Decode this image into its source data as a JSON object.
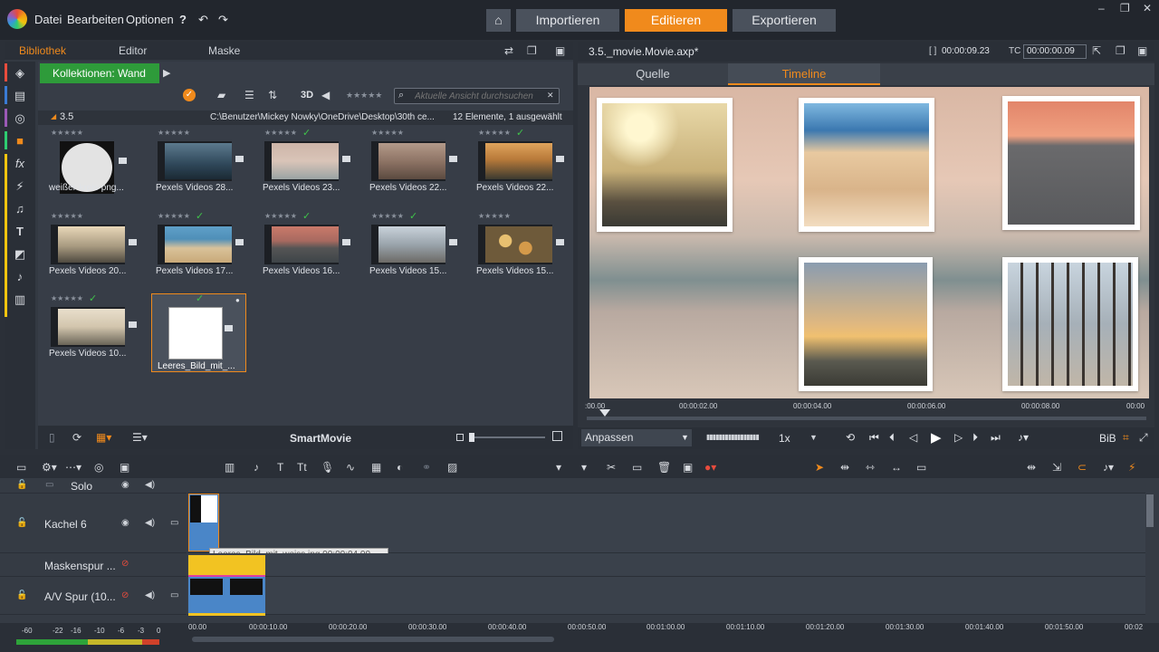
{
  "menu": {
    "datei": "Datei",
    "bearbeiten": "Bearbeiten",
    "optionen": "Optionen"
  },
  "modes": {
    "importieren": "Importieren",
    "editieren": "Editieren",
    "exportieren": "Exportieren"
  },
  "lib_tabs": {
    "bibliothek": "Bibliothek",
    "editor": "Editor",
    "maske": "Maske"
  },
  "collection": {
    "label": "Kollektionen: Wand"
  },
  "toolbar": {
    "three_d": "3D",
    "search_placeholder": "Aktuelle Ansicht durchsuchen"
  },
  "path": {
    "folder": "3.5",
    "path": "C:\\Benutzer\\Mickey Nowky\\OneDrive\\Desktop\\30th ce...",
    "count": "12 Elemente, 1 ausgewählt"
  },
  "items": [
    {
      "label": "weißer-kreis-png..."
    },
    {
      "label": "Pexels Videos 28..."
    },
    {
      "label": "Pexels Videos 23..."
    },
    {
      "label": "Pexels Videos 22..."
    },
    {
      "label": "Pexels Videos 22..."
    },
    {
      "label": "Pexels Videos 20..."
    },
    {
      "label": "Pexels Videos 17..."
    },
    {
      "label": "Pexels Videos 16..."
    },
    {
      "label": "Pexels Videos 15..."
    },
    {
      "label": "Pexels Videos 15..."
    },
    {
      "label": "Pexels Videos 10..."
    },
    {
      "label": "Leeres_Bild_mit_..."
    }
  ],
  "lib_bottom": {
    "smartmovie": "SmartMovie"
  },
  "preview": {
    "filename": "3.5._movie.Movie.axp*",
    "duration": "00:00:09.23",
    "tc_label": "TC",
    "timecode": "00:00:00.09",
    "tab_quelle": "Quelle",
    "tab_timeline": "Timeline"
  },
  "scrub_labels": [
    ":00.00",
    "00:00:02.00",
    "00:00:04.00",
    "00:00:06.00",
    "00:00:08.00",
    "00:00"
  ],
  "controls": {
    "fit": "Anpassen",
    "speed": "1x",
    "bib": "BiB"
  },
  "tracks": {
    "solo": "Solo",
    "kachel": "Kachel 6",
    "maske": "Maskenspur ...",
    "av": "A/V Spur (10..."
  },
  "tooltip": "Leeres_Bild_mit_weiss.jpg  00:00:04.00",
  "meter_labels": [
    "-60",
    "-22",
    "-16",
    "-10",
    "-6",
    "-3",
    "0"
  ],
  "ruler": [
    "00.00",
    "00:00:10.00",
    "00:00:20.00",
    "00:00:30.00",
    "00:00:40.00",
    "00:00:50.00",
    "00:01:00.00",
    "00:01:10.00",
    "00:01:20.00",
    "00:01:30.00",
    "00:01:40.00",
    "00:01:50.00",
    "00:02"
  ],
  "colors": {
    "accent": "#f08a1c",
    "green": "#2e9b3a"
  }
}
